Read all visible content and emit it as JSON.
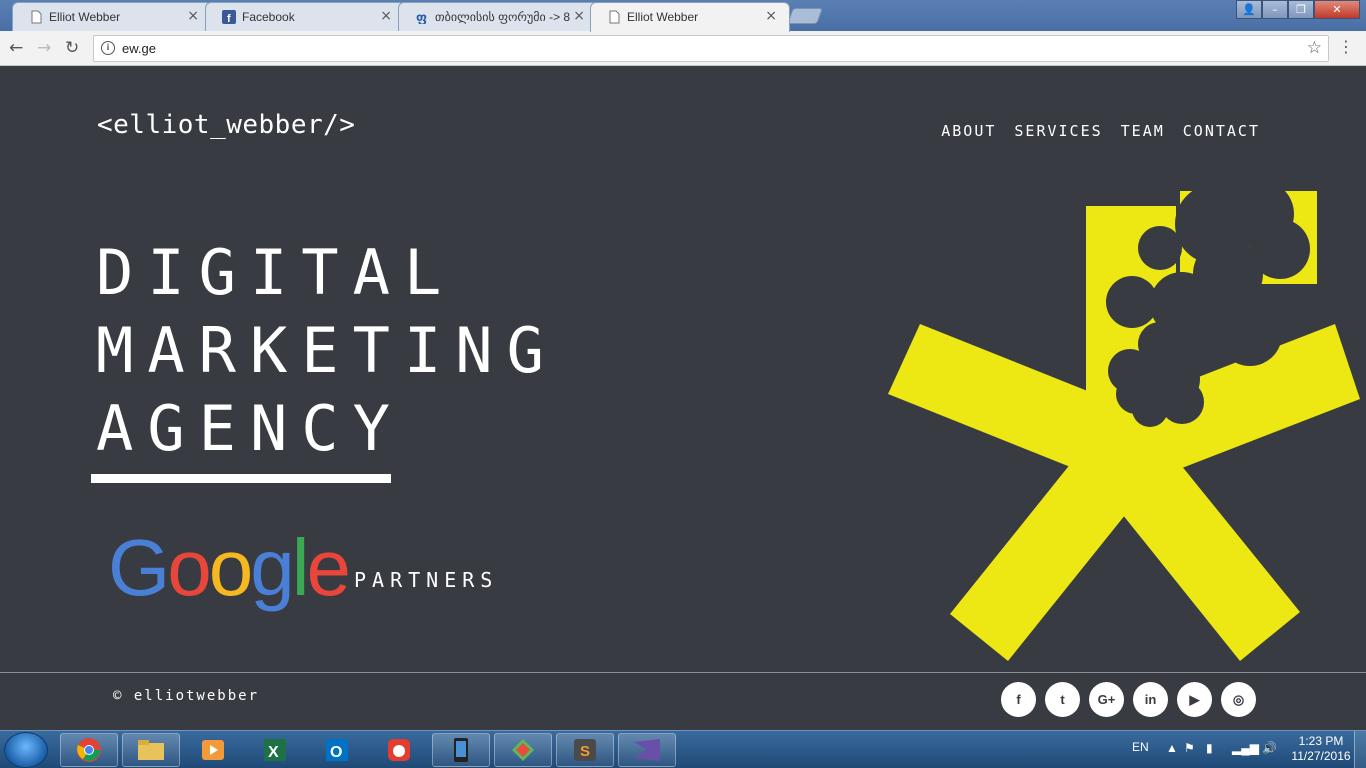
{
  "browser": {
    "tabs": [
      {
        "title": "Elliot Webber",
        "favicon": "page-icon"
      },
      {
        "title": "Facebook",
        "favicon": "facebook-icon"
      },
      {
        "title": "თბილისის ფორუმი -> 8",
        "favicon": "forum-icon"
      },
      {
        "title": "Elliot Webber",
        "favicon": "page-icon"
      }
    ],
    "close_glyph": "×",
    "url": "ew.ge"
  },
  "site": {
    "logo": "<elliot_webber/>",
    "nav": [
      "ABOUT",
      "SERVICES",
      "TEAM",
      "CONTACT"
    ],
    "hero": [
      "DIGITAL",
      "MARKETING",
      "AGENCY"
    ],
    "google_letters": [
      "G",
      "o",
      "o",
      "g",
      "l",
      "e"
    ],
    "google_colors": [
      "#4a7fd6",
      "#e8463a",
      "#f5b820",
      "#4a7fd6",
      "#3ba856",
      "#e8463a"
    ],
    "partners": "PARTNERS",
    "copyright": "© elliotwebber",
    "socials": [
      {
        "icon": "facebook-icon",
        "glyph": "f"
      },
      {
        "icon": "twitter-icon",
        "glyph": "t"
      },
      {
        "icon": "google-plus-icon",
        "glyph": "G+"
      },
      {
        "icon": "linkedin-icon",
        "glyph": "in"
      },
      {
        "icon": "youtube-icon",
        "glyph": "▶"
      },
      {
        "icon": "instagram-icon",
        "glyph": "◎"
      }
    ],
    "accent_color": "#ede814",
    "background_color": "#383b42"
  },
  "taskbar": {
    "apps": [
      "chrome-icon",
      "explorer-icon",
      "media-player-icon",
      "excel-icon",
      "outlook-icon",
      "app-icon",
      "phone-icon",
      "paint-icon",
      "sublime-icon",
      "visual-studio-icon"
    ],
    "language": "EN",
    "time": "1:23 PM",
    "date": "11/27/2016"
  }
}
